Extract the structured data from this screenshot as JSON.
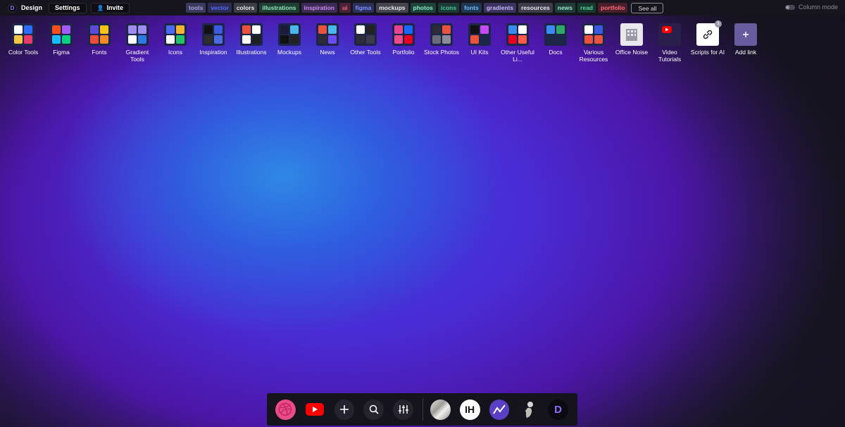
{
  "topbar": {
    "workspace": "Design",
    "settings_label": "Settings",
    "invite_label": "Invite",
    "tags": [
      {
        "label": "tools",
        "color": "#a7a3d6",
        "bg": "#3b3a5e"
      },
      {
        "label": "vector",
        "color": "#5a6cf5",
        "bg": "#2a2c55"
      },
      {
        "label": "colors",
        "color": "#e8e8f0",
        "bg": "#3c3c46"
      },
      {
        "label": "illustrations",
        "color": "#8fe5b8",
        "bg": "#1f3f35"
      },
      {
        "label": "inspiration",
        "color": "#c98cf2",
        "bg": "#3c2a55"
      },
      {
        "label": "ui",
        "color": "#f06a8c",
        "bg": "#4a2236"
      },
      {
        "label": "figma",
        "color": "#7c93ff",
        "bg": "#2b2f5a"
      },
      {
        "label": "mockups",
        "color": "#e8e8f0",
        "bg": "#44444e"
      },
      {
        "label": "photos",
        "color": "#8fe8c6",
        "bg": "#1d4438"
      },
      {
        "label": "icons",
        "color": "#45c9a0",
        "bg": "#1c3a36"
      },
      {
        "label": "fonts",
        "color": "#6fb8ff",
        "bg": "#1f3752"
      },
      {
        "label": "gradients",
        "color": "#c9b8f5",
        "bg": "#3a3260"
      },
      {
        "label": "resources",
        "color": "#e8e8f0",
        "bg": "#3d3c48"
      },
      {
        "label": "news",
        "color": "#9be0c7",
        "bg": "#1e3d38"
      },
      {
        "label": "read",
        "color": "#4fd39a",
        "bg": "#183a2c"
      },
      {
        "label": "portfolio",
        "color": "#ff6b7a",
        "bg": "#4a1f2c"
      }
    ],
    "see_all_label": "See all",
    "column_mode_label": "Column mode"
  },
  "grid": [
    {
      "label": "Color Tools",
      "icon": "color-tools-icon"
    },
    {
      "label": "Figma",
      "icon": "figma-icon"
    },
    {
      "label": "Fonts",
      "icon": "fonts-icon"
    },
    {
      "label": "Gradient Tools",
      "icon": "gradient-tools-icon"
    },
    {
      "label": "Icons",
      "icon": "icons-icon"
    },
    {
      "label": "Inspiration",
      "icon": "inspiration-icon"
    },
    {
      "label": "Illustrations",
      "icon": "illustrations-icon"
    },
    {
      "label": "Mockups",
      "icon": "mockups-icon"
    },
    {
      "label": "News",
      "icon": "news-icon"
    },
    {
      "label": "Other Tools",
      "icon": "other-tools-icon"
    },
    {
      "label": "Portfolio",
      "icon": "portfolio-icon"
    },
    {
      "label": "Stock Photos",
      "icon": "stock-photos-icon"
    },
    {
      "label": "UI Kits",
      "icon": "ui-kits-icon"
    },
    {
      "label": "Other Useful Li...",
      "icon": "other-useful-links-icon"
    },
    {
      "label": "Docs",
      "icon": "docs-icon"
    },
    {
      "label": "Various Resources",
      "icon": "various-resources-icon"
    },
    {
      "label": "Office Noise",
      "icon": "office-noise-icon"
    },
    {
      "label": "Video Tutorials",
      "icon": "video-tutorials-icon"
    },
    {
      "label": "Scripts for AI",
      "icon": "link-icon",
      "badge": "1"
    },
    {
      "label": "Add link",
      "icon": "plus-icon"
    }
  ],
  "dock": {
    "items": [
      "dribbble-icon",
      "youtube-icon",
      "plus-icon",
      "search-icon",
      "sliders-icon",
      "marble-avatar",
      "indiehackers-icon",
      "trend-icon",
      "figure-avatar",
      "d-logo-icon"
    ],
    "ih_text": "IH",
    "d_text": "D"
  }
}
